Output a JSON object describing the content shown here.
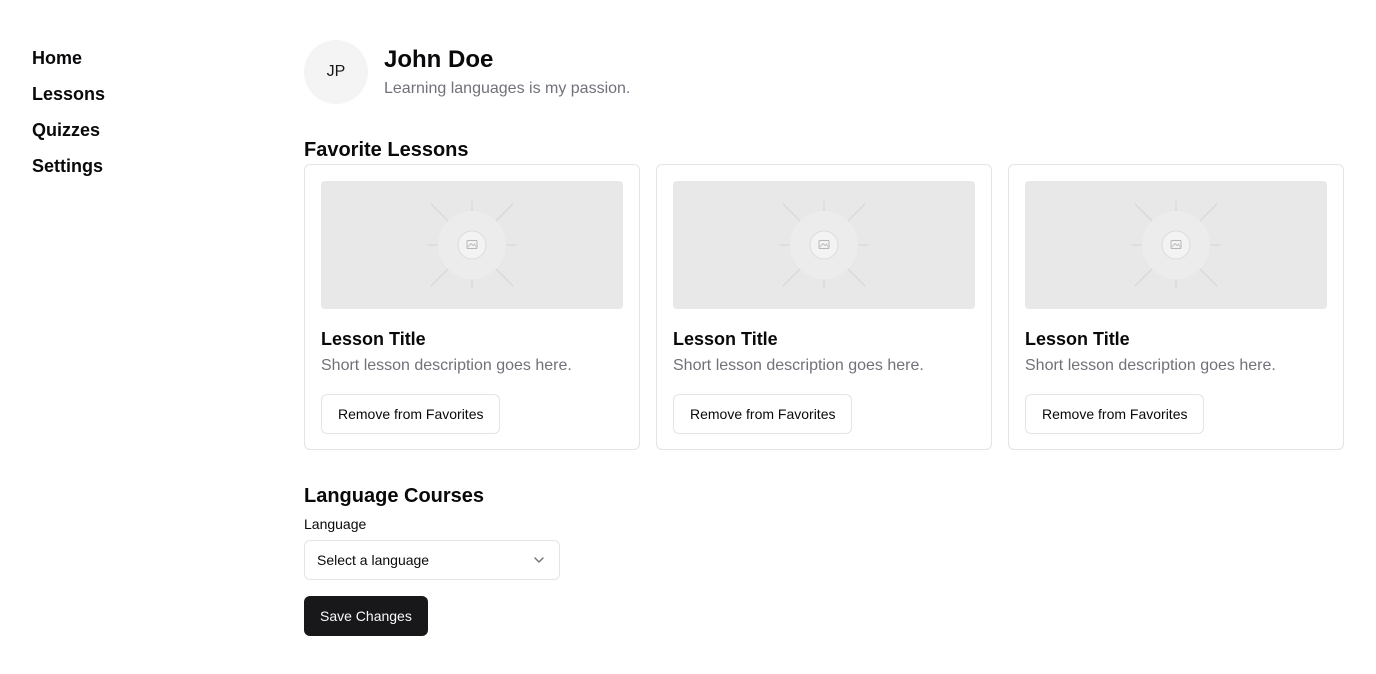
{
  "nav": {
    "items": [
      {
        "label": "Home"
      },
      {
        "label": "Lessons"
      },
      {
        "label": "Quizzes"
      },
      {
        "label": "Settings"
      }
    ]
  },
  "profile": {
    "initials": "JP",
    "name": "John Doe",
    "bio": "Learning languages is my passion."
  },
  "favorites": {
    "title": "Favorite Lessons",
    "cards": [
      {
        "title": "Lesson Title",
        "description": "Short lesson description goes here.",
        "button": "Remove from Favorites",
        "image_icon": "image-placeholder-icon"
      },
      {
        "title": "Lesson Title",
        "description": "Short lesson description goes here.",
        "button": "Remove from Favorites",
        "image_icon": "image-placeholder-icon"
      },
      {
        "title": "Lesson Title",
        "description": "Short lesson description goes here.",
        "button": "Remove from Favorites",
        "image_icon": "image-placeholder-icon"
      }
    ]
  },
  "courses": {
    "title": "Language Courses",
    "language_label": "Language",
    "language_select": {
      "value": "Select a language",
      "icon": "chevron-down-icon"
    },
    "save_label": "Save Changes"
  },
  "colors": {
    "primary": "#18181b",
    "muted_text": "#71717a",
    "border": "#e4e4e7",
    "image_placeholder": "#e8e8e8"
  }
}
